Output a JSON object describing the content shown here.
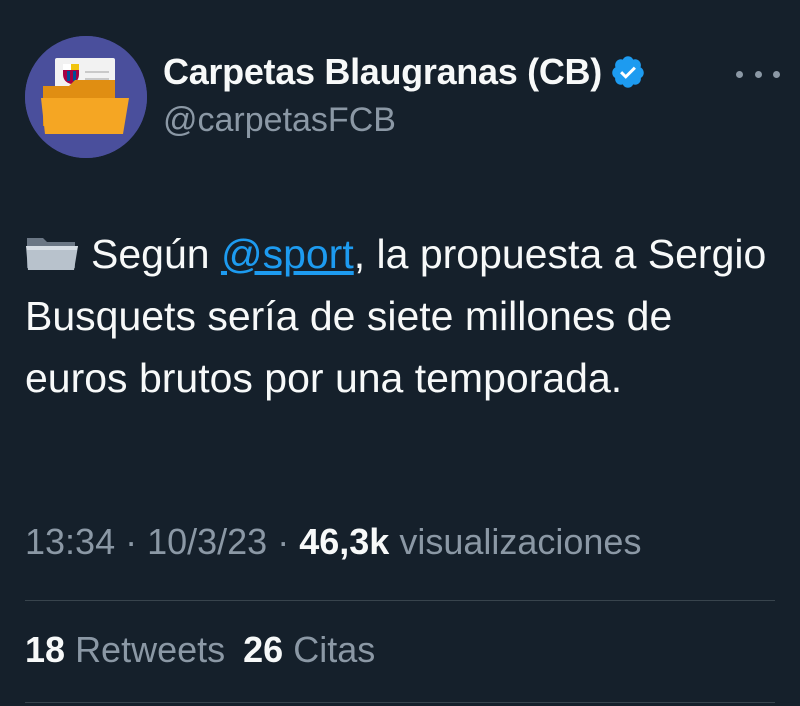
{
  "author": {
    "display_name": "Carpetas Blaugranas (CB)",
    "handle": "@carpetasFCB",
    "verified": true,
    "avatar_icon": "folder-with-crest-icon"
  },
  "tweet": {
    "emoji": "folder-icon",
    "text_before": "Según ",
    "mention": "@sport",
    "text_after": ", la propuesta a Sergio Busquets sería de siete millones de euros brutos por una temporada."
  },
  "meta": {
    "time": "13:34",
    "separator": " · ",
    "date": "10/3/23",
    "views_count": "46,3k",
    "views_label": "visualizaciones"
  },
  "stats": {
    "retweets_count": "18",
    "retweets_label": "Retweets",
    "quotes_count": "26",
    "quotes_label": "Citas"
  },
  "colors": {
    "background": "#15202b",
    "text": "#f7f9f9",
    "muted": "#8b98a5",
    "link": "#1d9bf0",
    "verified": "#1d9bf0",
    "avatar_bg": "#4a4f9c",
    "folder": "#f5a623"
  }
}
